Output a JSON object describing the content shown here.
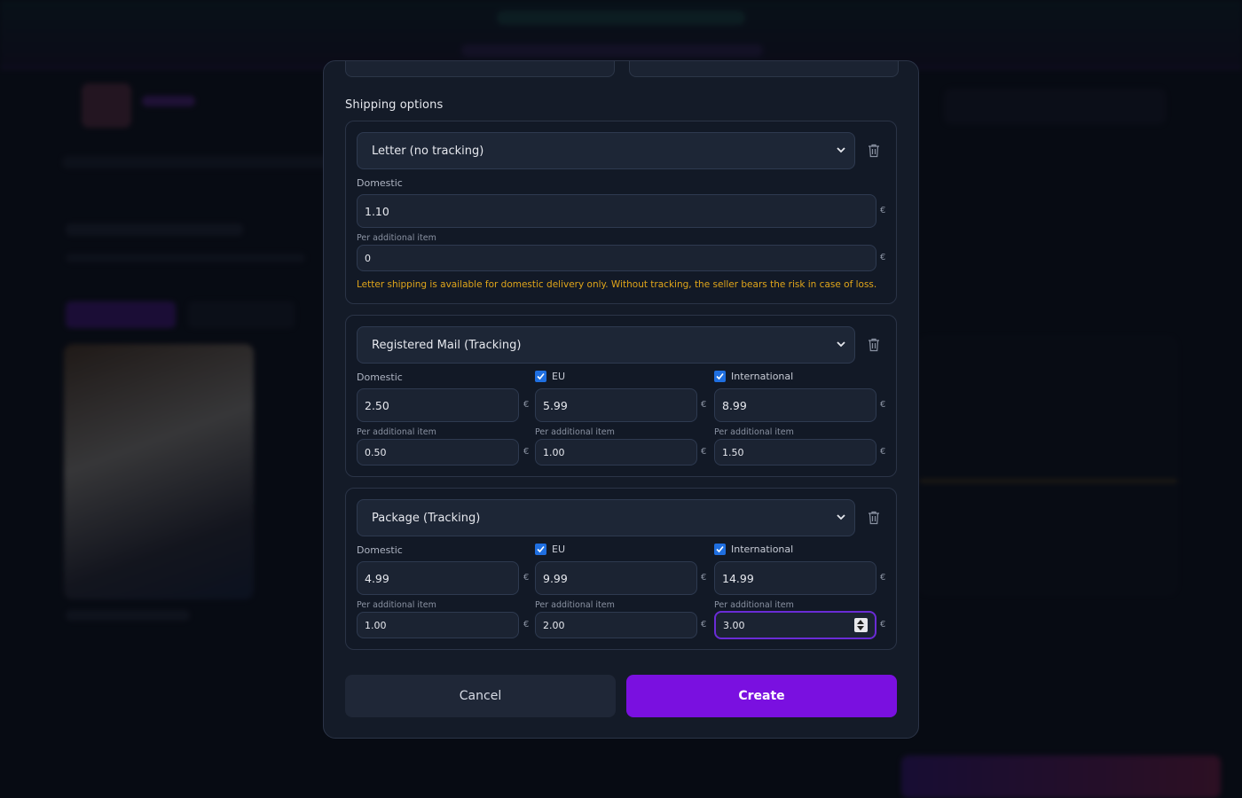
{
  "modal": {
    "section_title": "Shipping options",
    "currency_symbol": "€",
    "per_item_label": "Per additional item",
    "domestic_label": "Domestic",
    "eu_label": "EU",
    "international_label": "International",
    "options": [
      {
        "method": "Letter (no tracking)",
        "domestic": "1.10",
        "domestic_per_item": "0",
        "warning": "Letter shipping is available for domestic delivery only. Without tracking, the seller bears the risk in case of loss."
      },
      {
        "method": "Registered Mail (Tracking)",
        "domestic": "2.50",
        "domestic_per_item": "0.50",
        "eu_enabled": true,
        "eu": "5.99",
        "eu_per_item": "1.00",
        "international_enabled": true,
        "international": "8.99",
        "international_per_item": "1.50"
      },
      {
        "method": "Package (Tracking)",
        "domestic": "4.99",
        "domestic_per_item": "1.00",
        "eu_enabled": true,
        "eu": "9.99",
        "eu_per_item": "2.00",
        "international_enabled": true,
        "international": "14.99",
        "international_per_item": "3.00"
      }
    ],
    "cancel_label": "Cancel",
    "create_label": "Create"
  },
  "colors": {
    "accent": "#7a10e0",
    "warning": "#e0a51a",
    "checkbox": "#1f6fe0"
  }
}
